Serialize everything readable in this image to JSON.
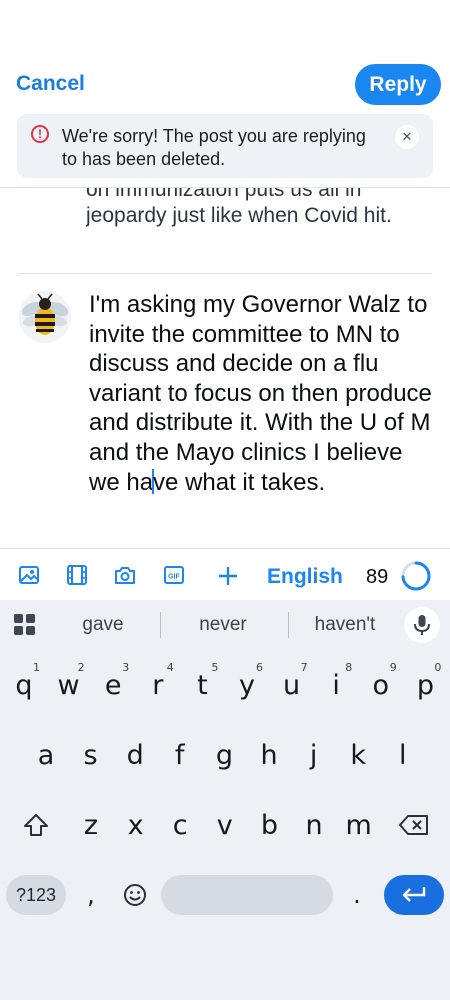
{
  "header": {
    "cancel_label": "Cancel",
    "reply_label": "Reply"
  },
  "notice": {
    "icon": "info-icon",
    "text": "We're sorry! The post you are replying to has been deleted.",
    "close_icon": "close-icon"
  },
  "quoted_post": {
    "text": "on immunization puts us all in jeopardy just like when Covid hit."
  },
  "composer": {
    "avatar": "bee-avatar",
    "text_before_caret": "I'm asking my Governor Walz to invite the committee to MN to discuss and decide on a flu variant to focus on then produce and distribute it. With the U of M and the Mayo clinics I believe we ha",
    "text_after_caret": "ve what it takes."
  },
  "toolbar": {
    "icons": [
      "image-icon",
      "video-icon",
      "camera-icon",
      "gif-icon",
      "plus-icon"
    ],
    "language": "English",
    "char_remaining": "89",
    "accent_color": "#1a86f0"
  },
  "keyboard": {
    "suggestions": [
      "gave",
      "never",
      "haven't"
    ],
    "row1": [
      {
        "key": "q",
        "hint": "1"
      },
      {
        "key": "w",
        "hint": "2"
      },
      {
        "key": "e",
        "hint": "3"
      },
      {
        "key": "r",
        "hint": "4"
      },
      {
        "key": "t",
        "hint": "5"
      },
      {
        "key": "y",
        "hint": "6"
      },
      {
        "key": "u",
        "hint": "7"
      },
      {
        "key": "i",
        "hint": "8"
      },
      {
        "key": "o",
        "hint": "9"
      },
      {
        "key": "p",
        "hint": "0"
      }
    ],
    "row2": [
      "a",
      "s",
      "d",
      "f",
      "g",
      "h",
      "j",
      "k",
      "l"
    ],
    "row3": [
      "z",
      "x",
      "c",
      "v",
      "b",
      "n",
      "m"
    ],
    "symbols_label": "?123",
    "comma": ",",
    "period": "."
  }
}
